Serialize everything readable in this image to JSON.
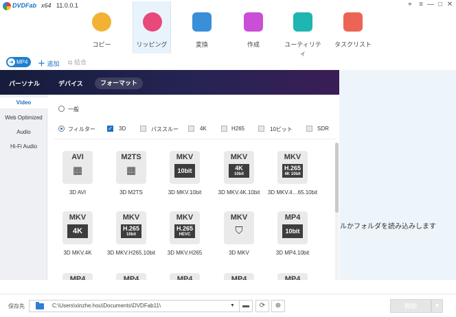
{
  "app": {
    "name": "DVDFab",
    "arch": "x64",
    "version": "11.0.0.1"
  },
  "window_controls": {
    "pin": "⌖",
    "menu": "≡",
    "minimize": "—",
    "maximize": "□",
    "close": "✕"
  },
  "nav": [
    {
      "label": "コピー",
      "color": "#f2b233",
      "active": false
    },
    {
      "label": "リッピング",
      "color": "#e8487a",
      "active": true
    },
    {
      "label": "変換",
      "color": "#3a8fd9",
      "active": false
    },
    {
      "label": "作成",
      "color": "#c94fd6",
      "active": false
    },
    {
      "label": "ユーティリティ",
      "color": "#1fb5b0",
      "active": false
    },
    {
      "label": "タスクリスト",
      "color": "#ec6456",
      "active": false
    }
  ],
  "mode": {
    "current": "MP4",
    "add_label": "追加",
    "merge_label": "結合"
  },
  "tabs": {
    "personal": "パーソナル",
    "device": "デバイス",
    "format": "フォーマット"
  },
  "categories": [
    "Video",
    "Web Optimized",
    "Audio",
    "Hi-Fi Audio"
  ],
  "filters": {
    "general_label": "一般",
    "filter_label": "フィルター",
    "options": [
      {
        "label": "3D",
        "checked": true
      },
      {
        "label": "パススルー",
        "checked": false
      },
      {
        "label": "4K",
        "checked": false
      },
      {
        "label": "H265",
        "checked": false
      },
      {
        "label": "10ビット",
        "checked": false
      },
      {
        "label": "SDR",
        "checked": false
      }
    ]
  },
  "formats": [
    {
      "name": "3D AVI",
      "top": "AVI",
      "badge_main": "",
      "badge_sub": "",
      "icon": "film-icon"
    },
    {
      "name": "3D M2TS",
      "top": "M2TS",
      "badge_main": "",
      "badge_sub": "",
      "icon": "film-icon"
    },
    {
      "name": "3D MKV.10bit",
      "top": "MKV",
      "badge_main": "10bit",
      "badge_sub": "",
      "icon": ""
    },
    {
      "name": "3D MKV.4K.10bit",
      "top": "MKV",
      "badge_main": "4K",
      "badge_sub": "10bit",
      "icon": ""
    },
    {
      "name": "3D MKV.4…65.10bit",
      "top": "MKV",
      "badge_main": "H.265",
      "badge_sub": "4K 10bit",
      "icon": ""
    },
    {
      "name": "3D MKV.4K",
      "top": "MKV",
      "badge_main": "4K",
      "badge_sub": "",
      "icon": ""
    },
    {
      "name": "3D MKV.H265.10bit",
      "top": "MKV",
      "badge_main": "H.265",
      "badge_sub": "10bit",
      "icon": ""
    },
    {
      "name": "3D MKV.H265",
      "top": "MKV",
      "badge_main": "H.265",
      "badge_sub": "HEVC",
      "icon": ""
    },
    {
      "name": "3D MKV",
      "top": "MKV",
      "badge_main": "",
      "badge_sub": "",
      "icon": "matroska-icon"
    },
    {
      "name": "3D MP4.10bit",
      "top": "MP4",
      "badge_main": "10bit",
      "badge_sub": "",
      "icon": ""
    },
    {
      "name": "",
      "top": "MP4",
      "badge_main": "",
      "badge_sub": "",
      "icon": ""
    },
    {
      "name": "",
      "top": "MP4",
      "badge_main": "",
      "badge_sub": "",
      "icon": ""
    },
    {
      "name": "",
      "top": "MP4",
      "badge_main": "",
      "badge_sub": "",
      "icon": ""
    },
    {
      "name": "",
      "top": "MP4",
      "badge_main": "",
      "badge_sub": "",
      "icon": ""
    },
    {
      "name": "",
      "top": "MP4",
      "badge_main": "",
      "badge_sub": "",
      "icon": ""
    }
  ],
  "right_pane": {
    "hint": "ルかフォルダを読み込みします"
  },
  "bottom": {
    "save_label": "保存先",
    "path": "C:\\Users\\xinzhe.hou\\Documents\\DVDFab11\\",
    "start_label": "開始"
  }
}
